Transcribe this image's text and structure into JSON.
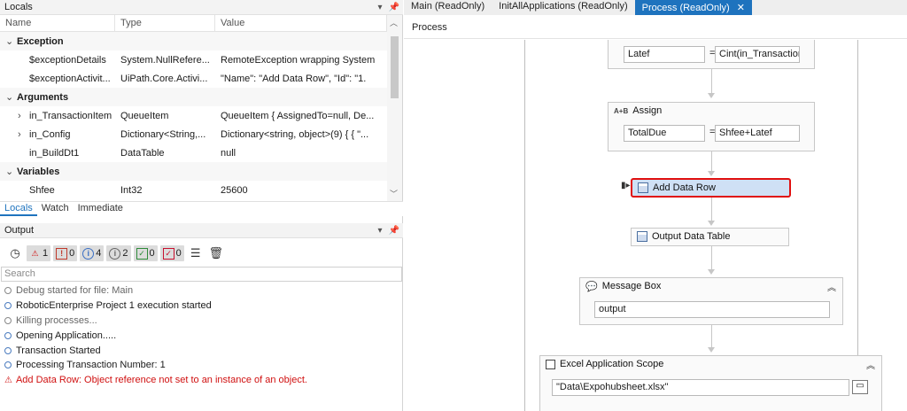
{
  "locals": {
    "title": "Locals",
    "columns": [
      "Name",
      "Type",
      "Value"
    ],
    "groups": [
      {
        "label": "Exception",
        "rows": [
          {
            "name": "$exceptionDetails",
            "type": "System.NullRefere...",
            "value": "RemoteException wrapping System"
          },
          {
            "name": "$exceptionActivit...",
            "type": "UiPath.Core.Activi...",
            "value": "\"Name\": \"Add Data Row\",  \"Id\": \"1."
          }
        ]
      },
      {
        "label": "Arguments",
        "rows": [
          {
            "name": "in_TransactionItem",
            "type": "QueueItem",
            "value": "QueueItem { AssignedTo=null, De..."
          },
          {
            "name": "in_Config",
            "type": "Dictionary<String,...",
            "value": "Dictionary<string, object>(9) { { \"..."
          },
          {
            "name": "in_BuildDt1",
            "type": "DataTable",
            "value": "null"
          }
        ]
      },
      {
        "label": "Variables",
        "rows": [
          {
            "name": "Shfee",
            "type": "Int32",
            "value": "25600"
          }
        ]
      }
    ]
  },
  "bottom_tabs": [
    "Locals",
    "Watch",
    "Immediate"
  ],
  "output": {
    "title": "Output",
    "filters": [
      {
        "icon": "error-triangle-icon",
        "count": "1",
        "color": "#d01010"
      },
      {
        "icon": "warning-icon",
        "count": "0",
        "color": "#c0392b"
      },
      {
        "icon": "info-icon",
        "count": "4",
        "color": "#3a6fc4"
      },
      {
        "icon": "trace-icon",
        "count": "2",
        "color": "#666666"
      },
      {
        "icon": "verbose-check-icon",
        "count": "0",
        "color": "#2e8b3a"
      },
      {
        "icon": "fatal-check-icon",
        "count": "0",
        "color": "#c8102e"
      }
    ],
    "search_placeholder": "Search",
    "log": [
      {
        "text": "Debug started for file: Main",
        "kind": "muted"
      },
      {
        "text": "RoboticEnterprise Project 1 execution started",
        "kind": "info"
      },
      {
        "text": "Killing processes...",
        "kind": "muted"
      },
      {
        "text": "Opening Application.....",
        "kind": "info"
      },
      {
        "text": "Transaction Started",
        "kind": "info"
      },
      {
        "text": "Processing Transaction Number: 1",
        "kind": "info"
      },
      {
        "text": "Add Data Row: Object reference not set to an instance of an object.",
        "kind": "error"
      }
    ]
  },
  "doc_tabs": [
    "Main (ReadOnly)",
    "InitAllApplications (ReadOnly)",
    "Process (ReadOnly)"
  ],
  "breadcrumb": "Process",
  "workflow": {
    "assign1": {
      "left": "Latef",
      "eq": "=",
      "right": "Cint(in_Transaction"
    },
    "assign2": {
      "badge": "A+B",
      "title": "Assign",
      "left": "TotalDue",
      "eq": "=",
      "right": "Shfee+Latef"
    },
    "add_data_row": "Add Data Row",
    "output_data_table": "Output Data Table",
    "message_box": {
      "title": "Message Box",
      "value": "output"
    },
    "excel_scope": {
      "title": "Excel Application Scope",
      "value": "\"Data\\Expohubsheet.xlsx\""
    }
  },
  "colors": {
    "accent": "#1e73be",
    "error": "#d01010",
    "highlight": "#e01010",
    "selected": "#cfe0f5"
  }
}
